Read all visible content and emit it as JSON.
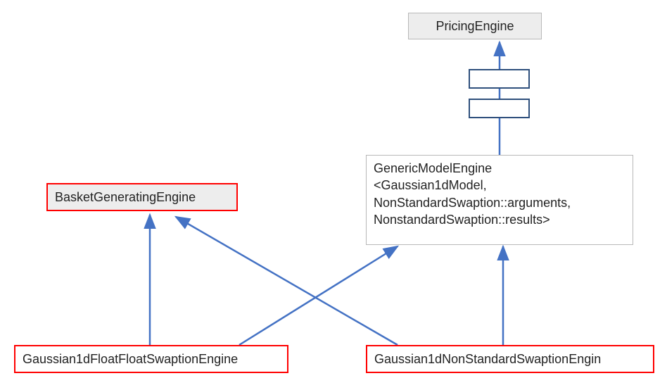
{
  "nodes": {
    "pricing_engine": "PricingEngine",
    "basket_generating_engine": "BasketGeneratingEngine",
    "generic_model_engine_line1": "GenericModelEngine",
    "generic_model_engine_line2": "<Gaussian1dModel,",
    "generic_model_engine_line3": "NonStandardSwaption::arguments,",
    "generic_model_engine_line4": "NonstandardSwaption::results>",
    "gaussian_float_float": "Gaussian1dFloatFloatSwaptionEngine",
    "gaussian_nonstandard": "Gaussian1dNonStandardSwaptionEngin"
  },
  "colors": {
    "arrow": "#4472c4",
    "red": "#ff0000",
    "gray": "#b8b8b8",
    "darknavy": "#2e4f7c"
  }
}
